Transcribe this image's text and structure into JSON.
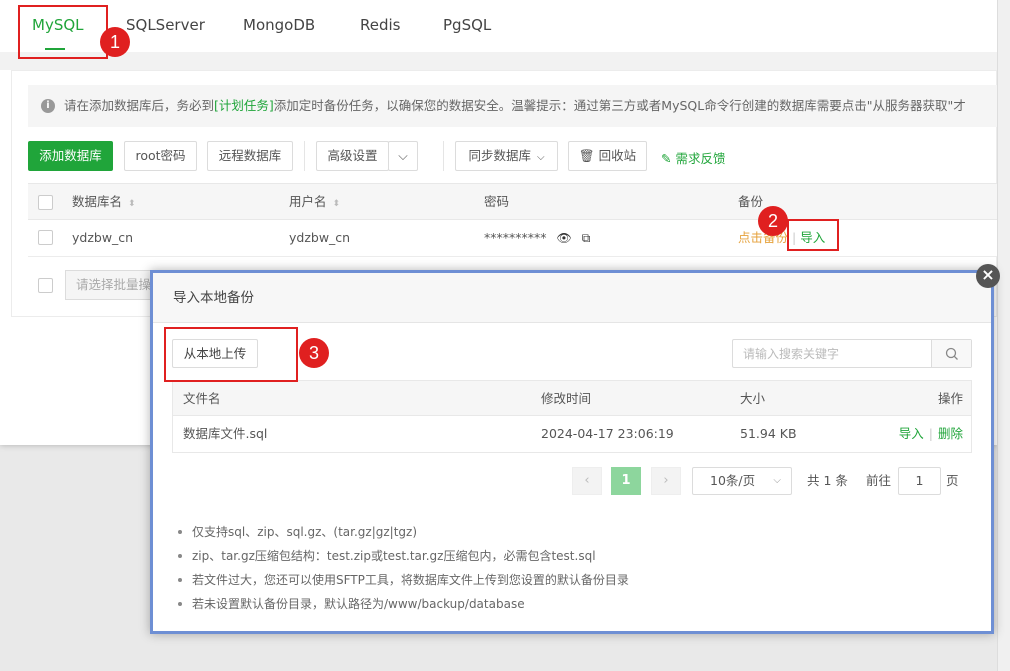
{
  "tabs": [
    "MySQL",
    "SQLServer",
    "MongoDB",
    "Redis",
    "PgSQL"
  ],
  "notice": {
    "prefix": "请在添加数据库后，务必到",
    "link": "[计划任务]",
    "suffix": "添加定时备份任务，以确保您的数据安全。温馨提示：通过第三方或者MySQL命令行创建的数据库需要点击\"从服务器获取\"才"
  },
  "toolbar": {
    "add_db": "添加数据库",
    "root_pw": "root密码",
    "remote_db": "远程数据库",
    "advanced": "高级设置",
    "sync_db": "同步数据库",
    "recycle": "回收站",
    "feedback": "需求反馈"
  },
  "db_table": {
    "headers": {
      "name": "数据库名",
      "user": "用户名",
      "password": "密码",
      "backup": "备份"
    },
    "rows": [
      {
        "name": "ydzbw_cn",
        "user": "ydzbw_cn",
        "password": "**********",
        "backup_action": "点击备份",
        "import_action": "导入"
      }
    ]
  },
  "batch_placeholder": "请选择批量操作",
  "annotations": [
    "1",
    "2",
    "3"
  ],
  "dialog": {
    "title": "导入本地备份",
    "upload_button": "从本地上传",
    "search_placeholder": "请输入搜索关键字",
    "table": {
      "headers": {
        "filename": "文件名",
        "mtime": "修改时间",
        "size": "大小",
        "ops": "操作"
      },
      "rows": [
        {
          "filename": "数据库文件.sql",
          "mtime": "2024-04-17 23:06:19",
          "size": "51.94 KB",
          "op_import": "导入",
          "op_delete": "删除"
        }
      ]
    },
    "pager": {
      "current": "1",
      "page_size": "10条/页",
      "total": "共 1 条",
      "goto_label": "前往",
      "goto_value": "1",
      "page_unit": "页"
    },
    "notes": [
      "仅支持sql、zip、sql.gz、(tar.gz|gz|tgz)",
      "zip、tar.gz压缩包结构：test.zip或test.tar.gz压缩包内，必需包含test.sql",
      "若文件过大，您还可以使用SFTP工具，将数据库文件上传到您设置的默认备份目录",
      "若未设置默认备份目录，默认路径为/www/backup/database"
    ]
  },
  "colors": {
    "accent": "#20a53a",
    "annotation": "#e02020",
    "warning": "#e6a23c"
  }
}
